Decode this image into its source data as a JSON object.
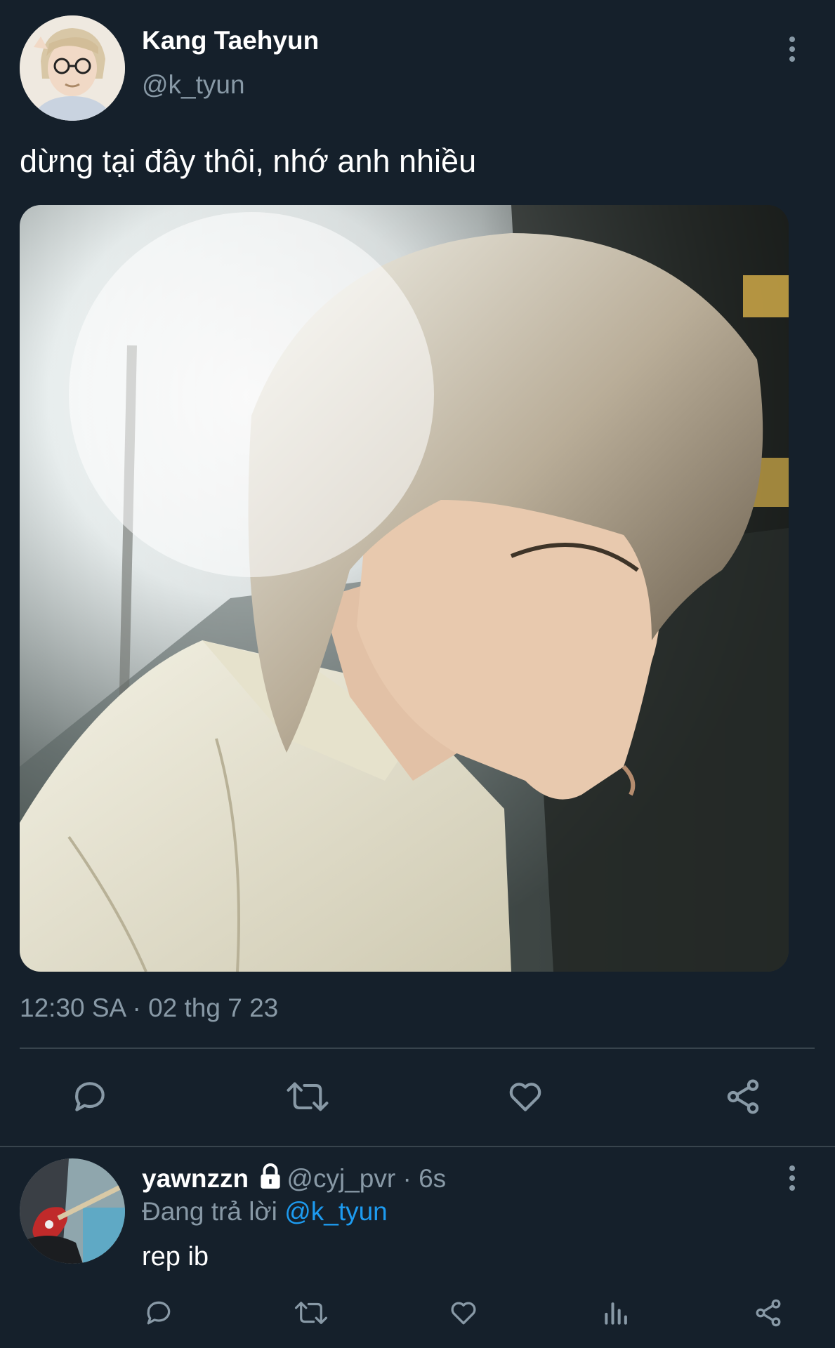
{
  "tweet": {
    "author_name": "Kang Taehyun",
    "author_handle": "@k_tyun",
    "text": "dừng tại đây thôi, nhớ anh nhiều",
    "timestamp": "12:30 SA · 02 thg 7 23",
    "avatar_icon": "user-photo",
    "media_icon": "profile-photo"
  },
  "reply": {
    "author_name": "yawnzzn",
    "author_handle": "@cyj_pvr",
    "separator": " · ",
    "age": "6s",
    "replying_prefix": "Đang trả lời",
    "replying_to": "@k_tyun",
    "text": "rep ib",
    "avatar_icon": "guitar-photo",
    "lock_icon": "lock-icon"
  },
  "colors": {
    "background": "#15202b",
    "muted": "#8899a6",
    "link": "#1d9bf0",
    "divider": "#38444d"
  }
}
